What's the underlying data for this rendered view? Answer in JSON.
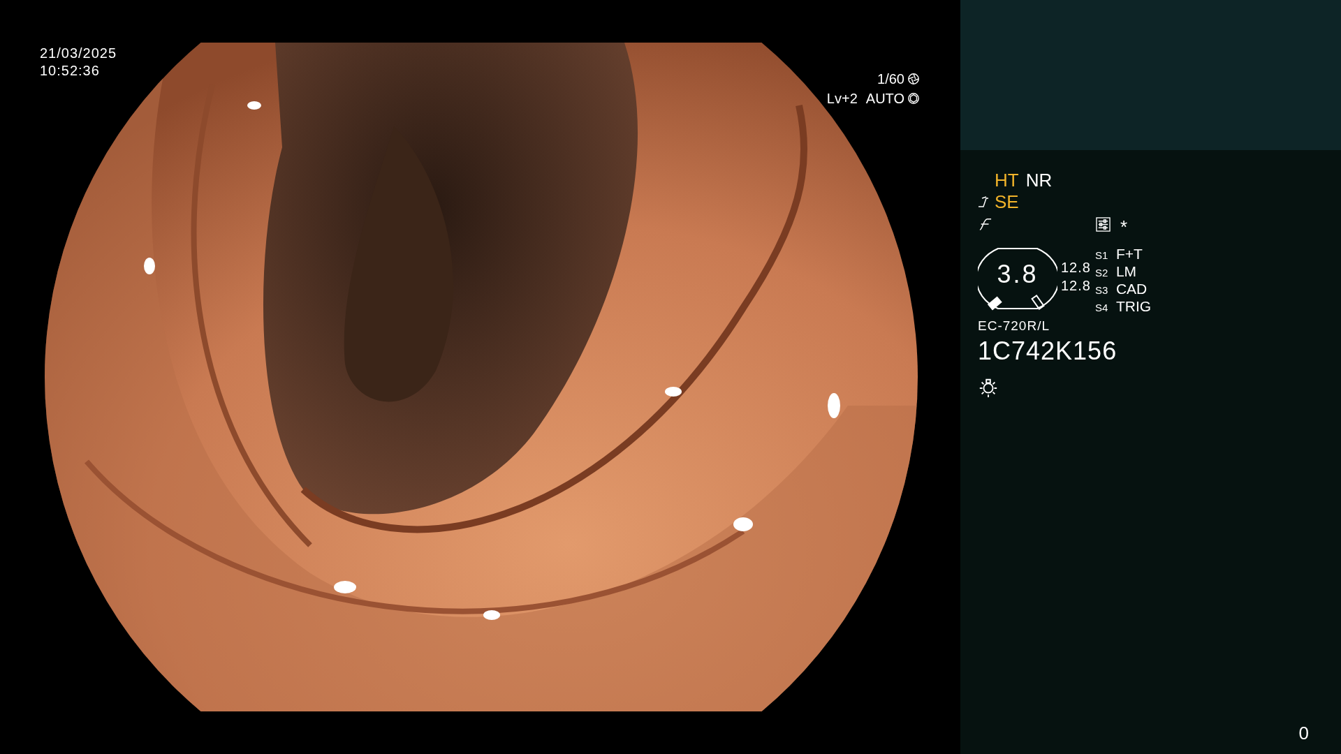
{
  "timestamp": {
    "date": "21/03/2025",
    "time": "10:52:36"
  },
  "exposure": {
    "shutter": "1/60",
    "level": "Lv+2",
    "mode": "AUTO"
  },
  "image_modes": [
    {
      "label": "HT",
      "on": true
    },
    {
      "label": "NR",
      "on": false
    }
  ],
  "enhancement": {
    "label": "SE",
    "on": true
  },
  "marker": "*",
  "scope": {
    "value": "3.8",
    "readings": [
      "12.8",
      "12.8"
    ],
    "model": "EC-720R/L",
    "serial": "1C742K156"
  },
  "switches": [
    {
      "key": "S1",
      "label": "F+T"
    },
    {
      "key": "S2",
      "label": "LM"
    },
    {
      "key": "S3",
      "label": "CAD"
    },
    {
      "key": "S4",
      "label": "TRIG"
    }
  ],
  "counter": "0"
}
